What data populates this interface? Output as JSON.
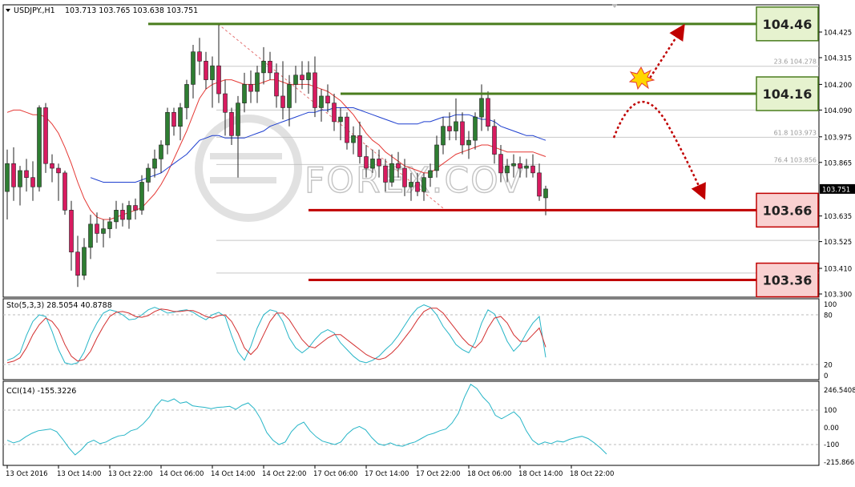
{
  "chart_data": [
    {
      "type": "candlestick",
      "header": {
        "symbol": "USDJPY.,H1",
        "ohlc_readout": "103.713 103.765 103.638 103.751"
      },
      "y_axis": {
        "ticks": [
          {
            "v": 104.425,
            "label": "104.425"
          },
          {
            "v": 104.315,
            "label": "104.315"
          },
          {
            "v": 104.2,
            "label": "104.200"
          },
          {
            "v": 104.09,
            "label": "104.090"
          },
          {
            "v": 103.975,
            "label": "103.975"
          },
          {
            "v": 103.865,
            "label": "103.865"
          },
          {
            "v": 103.635,
            "label": "103.635"
          },
          {
            "v": 103.525,
            "label": "103.525"
          },
          {
            "v": 103.41,
            "label": "103.410"
          },
          {
            "v": 103.3,
            "label": "103.300"
          }
        ],
        "current_price": {
          "v": 103.751,
          "label": "103.751"
        }
      },
      "levels": [
        {
          "v": 104.46,
          "label": "104.46",
          "kind": "resistance",
          "x_start": 22
        },
        {
          "v": 104.16,
          "label": "104.16",
          "kind": "resistance",
          "x_start": 52
        },
        {
          "v": 103.66,
          "label": "103.66",
          "kind": "support",
          "x_start": 47
        },
        {
          "v": 103.36,
          "label": "103.36",
          "kind": "support",
          "x_start": 47
        }
      ],
      "fibonacci": [
        {
          "v": 104.278,
          "label": "23.6 104.278"
        },
        {
          "v": 103.973,
          "label": "61.8 103.973"
        },
        {
          "v": 103.856,
          "label": "76.4 103.856"
        }
      ],
      "watermark": "FOREX.COV",
      "candles": [
        [
          103.74,
          103.92,
          103.62,
          103.86
        ],
        [
          103.86,
          103.93,
          103.7,
          103.76
        ],
        [
          103.76,
          103.85,
          103.68,
          103.83
        ],
        [
          103.83,
          103.88,
          103.74,
          103.8
        ],
        [
          103.8,
          103.87,
          103.7,
          103.76
        ],
        [
          103.76,
          104.11,
          103.74,
          104.1
        ],
        [
          104.1,
          104.12,
          103.82,
          103.86
        ],
        [
          103.86,
          103.9,
          103.78,
          103.84
        ],
        [
          103.84,
          103.86,
          103.7,
          103.82
        ],
        [
          103.82,
          103.83,
          103.64,
          103.66
        ],
        [
          103.66,
          103.7,
          103.4,
          103.48
        ],
        [
          103.48,
          103.55,
          103.33,
          103.38
        ],
        [
          103.38,
          103.54,
          103.36,
          103.5
        ],
        [
          103.5,
          103.64,
          103.45,
          103.6
        ],
        [
          103.6,
          103.65,
          103.52,
          103.56
        ],
        [
          103.56,
          103.62,
          103.5,
          103.58
        ],
        [
          103.58,
          103.63,
          103.54,
          103.61
        ],
        [
          103.61,
          103.7,
          103.58,
          103.66
        ],
        [
          103.66,
          103.69,
          103.59,
          103.62
        ],
        [
          103.62,
          103.7,
          103.58,
          103.68
        ],
        [
          103.68,
          103.71,
          103.62,
          103.66
        ],
        [
          103.66,
          103.81,
          103.64,
          103.78
        ],
        [
          103.78,
          103.86,
          103.74,
          103.84
        ],
        [
          103.84,
          103.92,
          103.8,
          103.88
        ],
        [
          103.88,
          103.96,
          103.82,
          103.94
        ],
        [
          103.94,
          104.1,
          103.9,
          104.08
        ],
        [
          104.08,
          104.1,
          103.98,
          104.02
        ],
        [
          104.02,
          104.12,
          103.96,
          104.1
        ],
        [
          104.1,
          104.22,
          104.05,
          104.2
        ],
        [
          104.2,
          104.37,
          104.14,
          104.34
        ],
        [
          104.34,
          104.4,
          104.24,
          104.3
        ],
        [
          104.3,
          104.34,
          104.18,
          104.22
        ],
        [
          104.22,
          104.32,
          104.1,
          104.28
        ],
        [
          104.28,
          104.46,
          104.12,
          104.16
        ],
        [
          104.16,
          104.22,
          103.98,
          104.08
        ],
        [
          104.08,
          104.1,
          103.94,
          103.98
        ],
        [
          103.98,
          104.15,
          103.8,
          104.12
        ],
        [
          104.12,
          104.25,
          104.08,
          104.2
        ],
        [
          104.2,
          104.26,
          104.12,
          104.17
        ],
        [
          104.17,
          104.28,
          104.12,
          104.25
        ],
        [
          104.25,
          104.36,
          104.2,
          104.3
        ],
        [
          104.3,
          104.34,
          104.22,
          104.25
        ],
        [
          104.25,
          104.29,
          104.1,
          104.15
        ],
        [
          104.15,
          104.3,
          104.05,
          104.1
        ],
        [
          104.1,
          104.24,
          104.02,
          104.2
        ],
        [
          104.2,
          104.28,
          104.12,
          104.24
        ],
        [
          104.24,
          104.3,
          104.18,
          104.22
        ],
        [
          104.22,
          104.3,
          104.16,
          104.25
        ],
        [
          104.25,
          104.32,
          104.06,
          104.1
        ],
        [
          104.1,
          104.18,
          104.04,
          104.15
        ],
        [
          104.15,
          104.2,
          104.08,
          104.12
        ],
        [
          104.12,
          104.16,
          104.0,
          104.04
        ],
        [
          104.04,
          104.1,
          103.96,
          104.06
        ],
        [
          104.06,
          104.08,
          103.92,
          103.95
        ],
        [
          103.95,
          104.02,
          103.9,
          103.98
        ],
        [
          103.98,
          104.04,
          103.86,
          103.89
        ],
        [
          103.89,
          103.94,
          103.8,
          103.84
        ],
        [
          103.84,
          103.92,
          103.82,
          103.88
        ],
        [
          103.88,
          103.92,
          103.8,
          103.85
        ],
        [
          103.85,
          103.88,
          103.74,
          103.78
        ],
        [
          103.78,
          103.9,
          103.76,
          103.86
        ],
        [
          103.86,
          103.91,
          103.8,
          103.84
        ],
        [
          103.84,
          103.88,
          103.72,
          103.76
        ],
        [
          103.76,
          103.82,
          103.7,
          103.78
        ],
        [
          103.78,
          103.82,
          103.72,
          103.74
        ],
        [
          103.74,
          103.82,
          103.7,
          103.8
        ],
        [
          103.8,
          103.86,
          103.76,
          103.83
        ],
        [
          103.83,
          103.98,
          103.8,
          103.94
        ],
        [
          103.94,
          104.06,
          103.9,
          104.02
        ],
        [
          104.02,
          104.08,
          103.96,
          104.0
        ],
        [
          104.0,
          104.14,
          103.96,
          104.04
        ],
        [
          104.04,
          104.08,
          103.9,
          103.94
        ],
        [
          103.94,
          104.0,
          103.88,
          103.96
        ],
        [
          103.96,
          104.08,
          103.92,
          104.06
        ],
        [
          104.06,
          104.2,
          104.0,
          104.14
        ],
        [
          104.14,
          104.17,
          104.0,
          104.02
        ],
        [
          104.02,
          104.05,
          103.86,
          103.9
        ],
        [
          103.9,
          103.94,
          103.78,
          103.82
        ],
        [
          103.82,
          103.88,
          103.78,
          103.85
        ],
        [
          103.85,
          103.9,
          103.8,
          103.86
        ],
        [
          103.86,
          103.89,
          103.8,
          103.84
        ],
        [
          103.84,
          103.88,
          103.8,
          103.85
        ],
        [
          103.85,
          103.9,
          103.8,
          103.82
        ],
        [
          103.82,
          103.86,
          103.7,
          103.72
        ],
        [
          103.713,
          103.765,
          103.638,
          103.751
        ]
      ],
      "ma_red": [
        104.08,
        104.09,
        104.09,
        104.08,
        104.07,
        104.07,
        104.06,
        104.03,
        103.99,
        103.93,
        103.86,
        103.78,
        103.71,
        103.66,
        103.63,
        103.62,
        103.62,
        103.63,
        103.64,
        103.65,
        103.66,
        103.67,
        103.7,
        103.73,
        103.77,
        103.82,
        103.88,
        103.94,
        104.0,
        104.07,
        104.14,
        104.18,
        104.2,
        104.21,
        104.22,
        104.22,
        104.21,
        104.2,
        104.2,
        104.2,
        104.21,
        104.22,
        104.22,
        104.21,
        104.2,
        104.2,
        104.2,
        104.2,
        104.19,
        104.18,
        104.17,
        104.15,
        104.13,
        104.1,
        104.07,
        104.03,
        103.99,
        103.96,
        103.94,
        103.91,
        103.89,
        103.87,
        103.85,
        103.84,
        103.83,
        103.82,
        103.82,
        103.84,
        103.86,
        103.88,
        103.9,
        103.91,
        103.92,
        103.93,
        103.94,
        103.94,
        103.93,
        103.92,
        103.91,
        103.91,
        103.91,
        103.91,
        103.91,
        103.9,
        103.89
      ],
      "ma_blue": [
        null,
        null,
        null,
        null,
        null,
        null,
        null,
        null,
        null,
        null,
        null,
        null,
        null,
        103.8,
        103.79,
        103.78,
        103.78,
        103.78,
        103.78,
        103.78,
        103.78,
        103.79,
        103.8,
        103.81,
        103.82,
        103.84,
        103.86,
        103.88,
        103.9,
        103.93,
        103.96,
        103.97,
        103.98,
        103.98,
        103.97,
        103.97,
        103.97,
        103.97,
        103.98,
        103.99,
        104.0,
        104.02,
        104.03,
        104.04,
        104.05,
        104.06,
        104.07,
        104.08,
        104.08,
        104.09,
        104.09,
        104.1,
        104.1,
        104.1,
        104.1,
        104.09,
        104.08,
        104.07,
        104.06,
        104.05,
        104.04,
        104.03,
        104.03,
        104.03,
        104.03,
        104.04,
        104.04,
        104.05,
        104.06,
        104.06,
        104.07,
        104.07,
        104.07,
        104.06,
        104.05,
        104.05,
        104.04,
        104.02,
        104.01,
        104.0,
        103.99,
        103.98,
        103.98,
        103.97,
        103.96
      ]
    },
    {
      "type": "line",
      "name": "stochastic",
      "header": "Sto(5,3,3) 28.5054 40.8788",
      "ylim": [
        0,
        100
      ],
      "ticks": [
        {
          "v": 100,
          "label": "100"
        },
        {
          "v": 80,
          "label": "80"
        },
        {
          "v": 20,
          "label": "20"
        },
        {
          "v": 0,
          "label": "0"
        }
      ],
      "levels": [
        80,
        20
      ],
      "main": [
        25,
        28,
        34,
        55,
        72,
        80,
        78,
        60,
        38,
        22,
        20,
        22,
        35,
        55,
        70,
        82,
        86,
        84,
        80,
        74,
        75,
        80,
        86,
        89,
        86,
        82,
        83,
        85,
        86,
        83,
        78,
        74,
        80,
        83,
        78,
        55,
        35,
        25,
        42,
        64,
        80,
        86,
        84,
        72,
        52,
        40,
        34,
        40,
        50,
        58,
        62,
        58,
        46,
        38,
        30,
        24,
        22,
        25,
        30,
        38,
        45,
        55,
        67,
        79,
        88,
        92,
        89,
        80,
        66,
        56,
        44,
        38,
        34,
        47,
        70,
        86,
        81,
        66,
        48,
        36,
        44,
        58,
        70,
        78,
        28.5054
      ],
      "signal": [
        22,
        24,
        28,
        40,
        56,
        68,
        76,
        72,
        62,
        44,
        30,
        24,
        26,
        36,
        52,
        66,
        78,
        83,
        84,
        82,
        78,
        77,
        79,
        84,
        87,
        86,
        84,
        84,
        85,
        85,
        82,
        78,
        76,
        79,
        80,
        72,
        58,
        40,
        32,
        40,
        56,
        72,
        82,
        82,
        74,
        62,
        50,
        42,
        40,
        46,
        52,
        56,
        56,
        50,
        44,
        38,
        32,
        28,
        26,
        28,
        34,
        42,
        52,
        62,
        74,
        84,
        88,
        88,
        82,
        72,
        62,
        52,
        44,
        40,
        48,
        64,
        76,
        78,
        70,
        56,
        48,
        48,
        56,
        64,
        40.8788
      ]
    },
    {
      "type": "line",
      "name": "cci",
      "header": "CCI(14) -155.3226",
      "ylim": [
        -215.8665,
        246.5408
      ],
      "ticks": [
        {
          "v": 246.5408,
          "label": "246.5408"
        },
        {
          "v": 100,
          "label": "100"
        },
        {
          "v": 0,
          "label": "0.00"
        },
        {
          "v": -100,
          "label": "-100"
        },
        {
          "v": -215.8665,
          "label": "-215.8665"
        }
      ],
      "levels": [
        100,
        -100
      ],
      "values": [
        -75,
        -90,
        -80,
        -55,
        -35,
        -20,
        -15,
        -10,
        -25,
        -70,
        -120,
        -160,
        -130,
        -90,
        -75,
        -95,
        -85,
        -65,
        -50,
        -45,
        -20,
        -10,
        20,
        60,
        120,
        160,
        150,
        165,
        140,
        148,
        125,
        120,
        116,
        108,
        116,
        118,
        122,
        104,
        128,
        142,
        108,
        50,
        -30,
        -75,
        -100,
        -85,
        -25,
        12,
        30,
        -20,
        -55,
        -80,
        -90,
        -100,
        -85,
        -40,
        -10,
        5,
        -15,
        -60,
        -95,
        -105,
        -90,
        -105,
        -110,
        -95,
        -85,
        -65,
        -45,
        -35,
        -20,
        -10,
        25,
        80,
        175,
        250,
        225,
        175,
        138,
        70,
        50,
        70,
        90,
        55,
        -20,
        -75,
        -100,
        -85,
        -95,
        -80,
        -85,
        -70,
        -60,
        -52,
        -65,
        -90,
        -120,
        -155.3226
      ]
    }
  ],
  "x_axis": {
    "labels": [
      {
        "label": "13 Oct 2016",
        "c": 0
      },
      {
        "label": "13 Oct 14:00",
        "c": 8
      },
      {
        "label": "13 Oct 22:00",
        "c": 16
      },
      {
        "label": "14 Oct 06:00",
        "c": 24
      },
      {
        "label": "14 Oct 14:00",
        "c": 32
      },
      {
        "label": "14 Oct 22:00",
        "c": 40
      },
      {
        "label": "17 Oct 06:00",
        "c": 48
      },
      {
        "label": "17 Oct 14:00",
        "c": 56
      },
      {
        "label": "17 Oct 22:00",
        "c": 64
      },
      {
        "label": "18 Oct 06:00",
        "c": 72
      },
      {
        "label": "18 Oct 14:00",
        "c": 80
      },
      {
        "label": "18 Oct 22:00",
        "c": 88
      }
    ]
  },
  "colors": {
    "bull_candle": "#2e7d32",
    "bear_candle": "#d81b60",
    "ma_red": "#e53935",
    "ma_blue": "#1e3fcf",
    "sto_main": "#26b5c7",
    "sto_signal": "#d32f2f",
    "cci": "#26b5c7",
    "resistance_line": "#4a7d1e",
    "resistance_box_bg": "#e6f2cf",
    "support_line": "#c00000",
    "support_box_bg": "#f9d1d1",
    "arrow": "#c00000",
    "grid": "#c8c8c8"
  }
}
